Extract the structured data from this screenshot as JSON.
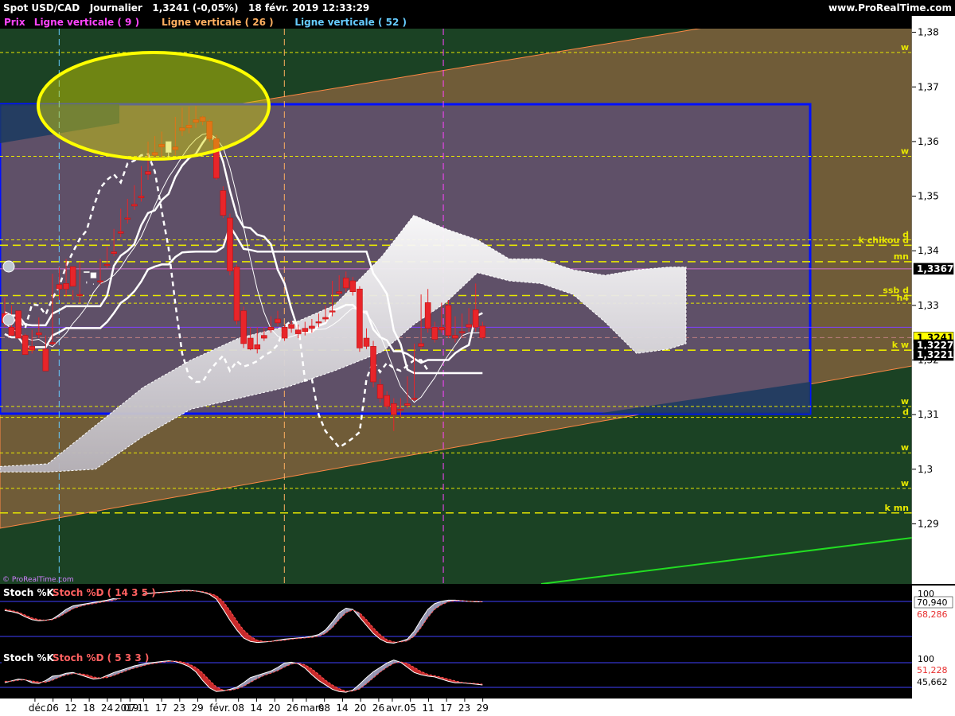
{
  "header": {
    "instrument": "Spot USD/CAD",
    "period": "Journalier",
    "quote": "1,3241 (-0,05%)",
    "datetime": "18 févr. 2019 12:33:29",
    "site": "www.ProRealTime.com"
  },
  "legend": [
    {
      "text": "Prix",
      "color": "#ff44ff"
    },
    {
      "text": "Ligne verticale ( 9 )",
      "color": "#ff44ff"
    },
    {
      "text": "Ligne verticale ( 26 )",
      "color": "#ffb060"
    },
    {
      "text": "Ligne verticale ( 52 )",
      "color": "#66ccff"
    }
  ],
  "watermark": "© ProRealTime.com",
  "colors": {
    "up": "#ffffff",
    "down": "#e8252a",
    "box": "#0010ff",
    "ellipse": "#ffff00",
    "level": "#e8e800",
    "green_line": "#22dd22",
    "channel": "#ff8040"
  },
  "chart_data": [
    {
      "type": "candlestick",
      "title": "Spot USD/CAD",
      "ylim": [
        1.279,
        1.383
      ],
      "y_ticks": [
        "1,38",
        "1,37",
        "1,36",
        "1,35",
        "1,34",
        "1,33",
        "1,32",
        "1,31",
        "1,3",
        "1,29"
      ],
      "y_tick_values": [
        1.38,
        1.37,
        1.36,
        1.35,
        1.34,
        1.33,
        1.32,
        1.31,
        1.3,
        1.29
      ],
      "x_ticks": [
        "déc.",
        "06",
        "12",
        "18",
        "24",
        "2019",
        "07",
        "11",
        "17",
        "23",
        "29",
        "févr.",
        "08",
        "14",
        "20",
        "26",
        "mars",
        "08",
        "14",
        "20",
        "26",
        "avr.",
        "05",
        "11",
        "17",
        "23",
        "29"
      ],
      "x_tick_index": [
        0,
        4,
        8,
        12,
        16,
        19,
        21,
        24,
        28,
        32,
        36,
        40,
        45,
        49,
        53,
        57,
        60,
        64,
        68,
        72,
        76,
        79,
        83,
        87,
        91,
        95,
        99
      ],
      "candles": [
        [
          1.3285,
          1.3315,
          1.3268,
          1.326
        ],
        [
          1.326,
          1.33,
          1.3245,
          1.3248
        ],
        [
          1.329,
          1.329,
          1.324,
          1.3262
        ],
        [
          1.3245,
          1.3248,
          1.321,
          1.3215
        ],
        [
          1.3225,
          1.3255,
          1.3218,
          1.3212
        ],
        [
          1.325,
          1.3278,
          1.3246,
          1.324
        ],
        [
          1.322,
          1.3245,
          1.318,
          1.3212
        ],
        [
          1.3232,
          1.3358,
          1.323,
          1.3228
        ],
        [
          1.3338,
          1.337,
          1.333,
          1.331
        ],
        [
          1.334,
          1.3385,
          1.333,
          1.3315
        ],
        [
          1.3371,
          1.3328,
          1.3335,
          1.331
        ],
        [
          1.332,
          1.338,
          1.3318,
          1.3305
        ],
        [
          1.336,
          1.3344,
          1.3362,
          1.334
        ],
        [
          1.335,
          1.334,
          1.336,
          1.3338
        ],
        [
          1.3345,
          1.3385,
          1.3343,
          1.3338
        ],
        [
          1.3375,
          1.3408,
          1.3373,
          1.3368
        ],
        [
          1.3398,
          1.344,
          1.3395,
          1.339
        ],
        [
          1.3435,
          1.3477,
          1.3432,
          1.3425
        ],
        [
          1.346,
          1.3495,
          1.3458,
          1.345
        ],
        [
          1.3485,
          1.352,
          1.3482,
          1.3475
        ],
        [
          1.35,
          1.3555,
          1.3497,
          1.349
        ],
        [
          1.3545,
          1.36,
          1.354,
          1.353
        ],
        [
          1.358,
          1.361,
          1.3575,
          1.357
        ],
        [
          1.3595,
          1.3618,
          1.359,
          1.3565
        ],
        [
          1.358,
          1.359,
          1.36,
          1.357
        ],
        [
          1.359,
          1.3645,
          1.3585,
          1.3575
        ],
        [
          1.3625,
          1.3662,
          1.362,
          1.361
        ],
        [
          1.363,
          1.3664,
          1.3625,
          1.3615
        ],
        [
          1.364,
          1.3665,
          1.3635,
          1.3625
        ],
        [
          1.3645,
          1.3647,
          1.3637,
          1.363
        ],
        [
          1.3637,
          1.364,
          1.3605,
          1.36
        ],
        [
          1.3605,
          1.3612,
          1.3533,
          1.353
        ],
        [
          1.351,
          1.3518,
          1.3465,
          1.346
        ],
        [
          1.346,
          1.3468,
          1.3363,
          1.3355
        ],
        [
          1.337,
          1.3375,
          1.3272,
          1.3265
        ],
        [
          1.329,
          1.3298,
          1.323,
          1.3222
        ],
        [
          1.324,
          1.326,
          1.322,
          1.3218
        ],
        [
          1.3228,
          1.326,
          1.322,
          1.3212
        ],
        [
          1.3245,
          1.326,
          1.324,
          1.3235
        ],
        [
          1.326,
          1.328,
          1.3255,
          1.325
        ],
        [
          1.3275,
          1.329,
          1.3268,
          1.3262
        ],
        [
          1.326,
          1.3265,
          1.324,
          1.3235
        ],
        [
          1.3265,
          1.3272,
          1.3258,
          1.325
        ],
        [
          1.3255,
          1.3265,
          1.3248,
          1.324
        ],
        [
          1.3258,
          1.327,
          1.3252,
          1.3245
        ],
        [
          1.3262,
          1.3275,
          1.3258,
          1.325
        ],
        [
          1.327,
          1.3285,
          1.3268,
          1.326
        ],
        [
          1.3278,
          1.33,
          1.3275,
          1.327
        ],
        [
          1.329,
          1.3345,
          1.3288,
          1.328
        ],
        [
          1.3325,
          1.3355,
          1.3322,
          1.3318
        ],
        [
          1.335,
          1.3362,
          1.3332,
          1.3325
        ],
        [
          1.3345,
          1.3352,
          1.3325,
          1.3318
        ],
        [
          1.333,
          1.3335,
          1.3222,
          1.3215
        ],
        [
          1.324,
          1.3258,
          1.3225,
          1.322
        ],
        [
          1.3225,
          1.3235,
          1.316,
          1.315
        ],
        [
          1.3155,
          1.3165,
          1.313,
          1.3122
        ],
        [
          1.3135,
          1.3143,
          1.3115,
          1.311
        ],
        [
          1.312,
          1.313,
          1.31,
          1.307
        ],
        [
          1.311,
          1.313,
          1.3108,
          1.3095
        ],
        [
          1.312,
          1.317,
          1.3117,
          1.3112
        ],
        [
          1.313,
          1.323,
          1.3128,
          1.3125
        ],
        [
          1.323,
          1.332,
          1.3225,
          1.322
        ],
        [
          1.3305,
          1.333,
          1.3258,
          1.325
        ],
        [
          1.326,
          1.327,
          1.3238,
          1.3232
        ],
        [
          1.326,
          1.3305,
          1.3255,
          1.325
        ],
        [
          1.33,
          1.331,
          1.3245,
          1.324
        ],
        [
          1.3245,
          1.328,
          1.324,
          1.3232
        ],
        [
          1.3252,
          1.3285,
          1.325,
          1.324
        ],
        [
          1.3265,
          1.3295,
          1.326,
          1.3252
        ],
        [
          1.3292,
          1.334,
          1.326,
          1.3252
        ],
        [
          1.3262,
          1.327,
          1.3241,
          1.3238
        ]
      ],
      "last_price": "1,3241",
      "price_markers": [
        {
          "label": "1,3367",
          "value": 1.3367,
          "color": "#ffffff",
          "bg": "#000000"
        },
        {
          "label": "1,3241",
          "value": 1.3241,
          "color": "#000000",
          "bg": "#ffff00"
        },
        {
          "label": "1,3227",
          "value": 1.3227,
          "color": "#ffffff",
          "bg": "#000000"
        },
        {
          "label": "1,3221",
          "value": 1.3221,
          "color": "#ffffff",
          "bg": "#000000"
        }
      ],
      "levels": [
        {
          "value": 1.3763,
          "label": "w",
          "style": "dash"
        },
        {
          "value": 1.3573,
          "label": "w",
          "style": "dash"
        },
        {
          "value": 1.342,
          "label": "d",
          "style": "dash"
        },
        {
          "value": 1.341,
          "label": "k chikou d",
          "style": "longdash"
        },
        {
          "value": 1.338,
          "label": "mn",
          "style": "longdash"
        },
        {
          "value": 1.3318,
          "label": "ssb d",
          "style": "longdash"
        },
        {
          "value": 1.3304,
          "label": "h4",
          "style": "dash"
        },
        {
          "value": 1.3218,
          "label": "k w",
          "style": "longdash"
        },
        {
          "value": 1.3115,
          "label": "w",
          "style": "dash"
        },
        {
          "value": 1.3095,
          "label": "d",
          "style": "dash"
        },
        {
          "value": 1.303,
          "label": "w",
          "style": "dash"
        },
        {
          "value": 1.2965,
          "label": "w",
          "style": "dash"
        },
        {
          "value": 1.292,
          "label": "k mn",
          "style": "longdash"
        }
      ],
      "vertical_lines": [
        {
          "x_index": 8,
          "color": "#66ccff"
        },
        {
          "x_index": 42,
          "color": "#ffb060"
        },
        {
          "x_index": 66,
          "color": "#ff44ff"
        }
      ],
      "box": {
        "x_start_index": 0,
        "x_end_index": 135,
        "y_top": 1.3645,
        "y_bottom": 1.3088
      },
      "ellipse": {
        "x_center_index": 23,
        "y_center": 1.3624,
        "rx_index": 18,
        "ry": 0.0097
      }
    },
    {
      "type": "line",
      "title": "Stoch %K",
      "subtitle": "Stoch %D ( 14 3 5 )",
      "ylim": [
        0,
        100
      ],
      "y_ticks": [
        "100",
        "70,940",
        "68,286"
      ],
      "k_last": "70,940",
      "d_last": "68,286",
      "k": [
        62,
        60,
        57,
        51,
        46,
        44,
        45,
        47,
        55,
        64,
        70,
        72,
        74,
        76,
        78,
        80,
        83,
        86,
        88,
        90,
        91,
        92,
        93,
        94,
        95,
        96,
        97,
        97,
        96,
        94,
        90,
        82,
        64,
        45,
        28,
        14,
        8,
        6,
        7,
        8,
        10,
        12,
        13,
        14,
        15,
        17,
        20,
        28,
        42,
        58,
        66,
        64,
        50,
        36,
        22,
        12,
        6,
        5,
        8,
        12,
        26,
        46,
        64,
        74,
        78,
        80,
        80,
        79,
        78,
        77,
        77
      ],
      "d": [
        64,
        62,
        59,
        54,
        49,
        46,
        45,
        46,
        51,
        58,
        65,
        69,
        72,
        74,
        76,
        78,
        80,
        83,
        86,
        88,
        90,
        91,
        92,
        93,
        94,
        95,
        96,
        96,
        96,
        95,
        92,
        88,
        78,
        62,
        44,
        28,
        17,
        10,
        8,
        8,
        9,
        10,
        12,
        13,
        14,
        15,
        17,
        22,
        32,
        46,
        58,
        63,
        58,
        46,
        32,
        20,
        11,
        7,
        7,
        9,
        17,
        32,
        50,
        64,
        72,
        77,
        79,
        79,
        78,
        78,
        77
      ]
    },
    {
      "type": "line",
      "title": "Stoch %K",
      "subtitle": "Stoch %D ( 5 3 3 )",
      "ylim": [
        0,
        100
      ],
      "y_ticks": [
        "100",
        "51,228",
        "45,662"
      ],
      "k_last": "51,228",
      "d_last": "45,662",
      "k": [
        30,
        35,
        40,
        38,
        30,
        28,
        36,
        48,
        50,
        56,
        58,
        52,
        46,
        40,
        42,
        50,
        58,
        64,
        70,
        76,
        80,
        84,
        86,
        88,
        90,
        88,
        82,
        74,
        60,
        36,
        16,
        6,
        8,
        12,
        18,
        30,
        44,
        50,
        56,
        62,
        72,
        84,
        86,
        82,
        70,
        52,
        36,
        24,
        12,
        6,
        4,
        10,
        26,
        44,
        60,
        72,
        84,
        92,
        86,
        72,
        58,
        52,
        48,
        46,
        40,
        34,
        30,
        30,
        28,
        26,
        24
      ],
      "d": [
        34,
        34,
        37,
        38,
        35,
        32,
        31,
        37,
        45,
        51,
        55,
        55,
        52,
        46,
        43,
        44,
        50,
        57,
        64,
        70,
        75,
        80,
        83,
        86,
        88,
        89,
        87,
        81,
        72,
        57,
        37,
        19,
        10,
        9,
        13,
        20,
        31,
        41,
        50,
        56,
        63,
        73,
        81,
        84,
        79,
        68,
        53,
        37,
        24,
        14,
        7,
        7,
        13,
        27,
        43,
        59,
        72,
        83,
        87,
        83,
        72,
        61,
        53,
        49,
        45,
        40,
        35,
        31,
        29,
        28,
        26
      ]
    }
  ]
}
